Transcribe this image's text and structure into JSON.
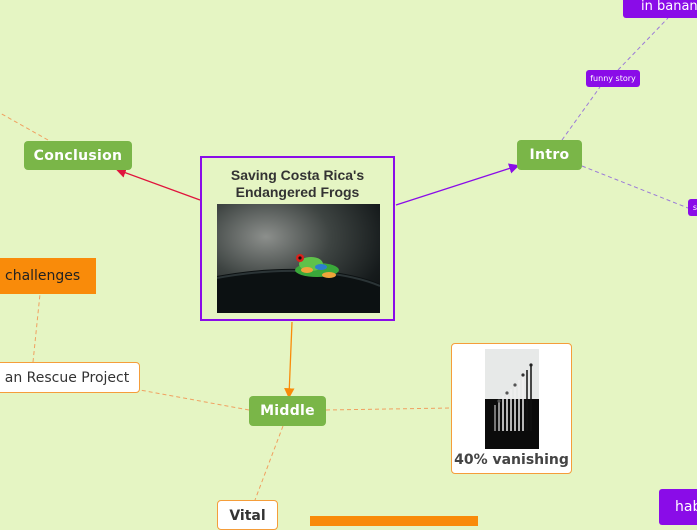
{
  "central_topic": {
    "title_line1": "Saving Costa Rica's",
    "title_line2": "Endangered Frogs"
  },
  "nodes": {
    "intro": "Intro",
    "conclusion": "Conclusion",
    "middle": "Middle",
    "vital": "Vital",
    "challenges": "challenges",
    "rescue_project": "an Rescue Project",
    "vanishing": "40% vanishing",
    "in_banana": "in banan",
    "funny_story": "funny story",
    "hab": "hab",
    "small_purple": "s"
  },
  "colors": {
    "background": "#e5f5c3",
    "green": "#7ab648",
    "purple": "#8a0ce8",
    "orange": "#f98b0a",
    "red_link": "#e0143c"
  }
}
